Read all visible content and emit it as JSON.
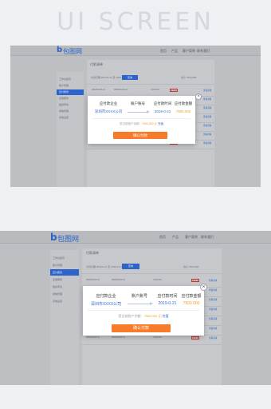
{
  "hero": {
    "title": "UI SCREEN"
  },
  "brand": {
    "logo_letter": "b",
    "name": "包图网"
  },
  "nav": {
    "items": [
      "首页",
      "产品",
      "客户案例",
      "联系我们"
    ]
  },
  "sidebar": {
    "items": [
      "工作台首页",
      "账户管理",
      "应付账款",
      "应收账款",
      "融资申请",
      "授信管理",
      "系统设置"
    ],
    "active_index": 2
  },
  "main": {
    "breadcrumb": "付款清单",
    "filter_label": "付款日期 2019-0-21 至 2019-12-31",
    "filter_button": "查询",
    "total_label": "合计 7500.000",
    "rows": [
      {
        "id": "ZB0000015-01",
        "code": "ZB0000015-01",
        "amount": "7500.000",
        "tag": "未付款",
        "action": "查看详情"
      },
      {
        "id": "ZB0000015-01",
        "code": "ZB0000015-01",
        "amount": "7500.000",
        "tag": "未付款",
        "action": "查看详情"
      },
      {
        "id": "ZB0000015-01",
        "code": "ZB0000015-01",
        "amount": "7500.000",
        "tag": "未付款",
        "action": "查看详情"
      },
      {
        "id": "ZB0000015-01",
        "code": "ZB0000015-01",
        "amount": "7500.000",
        "tag": "未付款",
        "action": "查看详情"
      },
      {
        "id": "ZB0000015-01",
        "code": "ZB0000015-01",
        "amount": "7500.000",
        "tag": "未付款",
        "action": "查看详情"
      },
      {
        "id": "ZB0000015-01",
        "code": "ZB0000015-01",
        "amount": "7500.000",
        "tag": "未付款",
        "action": "查看详情"
      },
      {
        "id": "ZB0000015-01",
        "code": "ZB0000015-01",
        "amount": "7500.000",
        "tag": "未付款",
        "action": "查看详情"
      }
    ]
  },
  "modal": {
    "col_payer": "应付款企业",
    "col_account": "账户账号",
    "col_date": "应付款时间",
    "col_amount": "应付款金额",
    "payer": "深圳市XXXX公司",
    "date": "2019-0-21",
    "amount": "7500.000",
    "note_prefix": "您当前账户余额：",
    "note_amount": "7500.000 元",
    "note_link": "充值",
    "confirm": "确认付款",
    "close": "×"
  },
  "colors": {
    "primary": "#2c64c9",
    "accent": "#f77b2b",
    "amount": "#f39a2c"
  }
}
